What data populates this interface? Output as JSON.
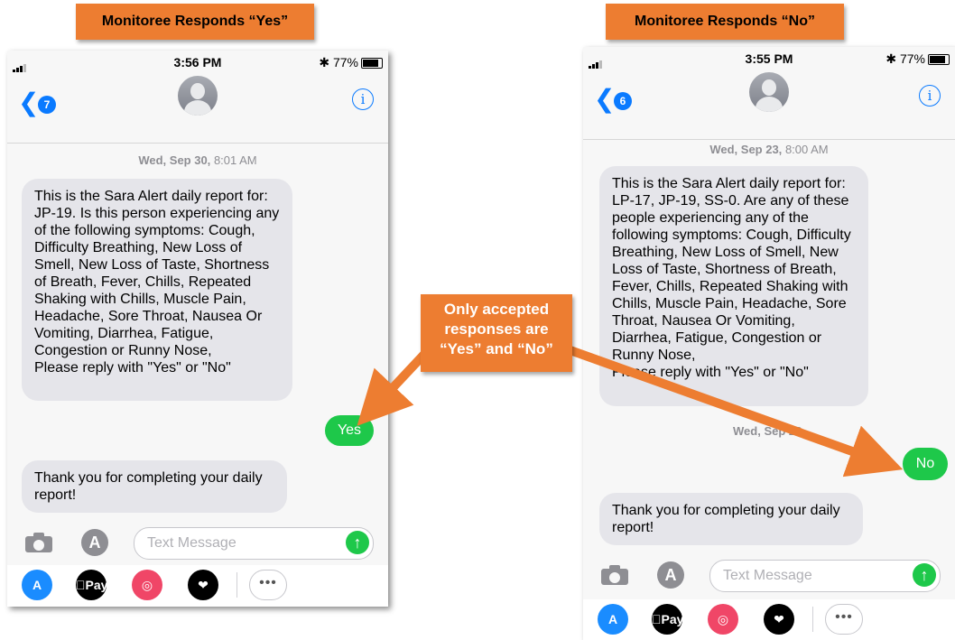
{
  "left": {
    "banner": "Monitoree Responds “Yes”",
    "time": "3:56 PM",
    "battery": "77%",
    "back_count": "7",
    "date_bold": "Wed, Sep 30,",
    "date_time": "8:01 AM",
    "message": "This is the Sara Alert daily report for: JP-19. Is this person experiencing any of the following symptoms: Cough, Difficulty Breathing, New Loss of Smell, New Loss of Taste, Shortness of Breath, Fever, Chills, Repeated Shaking with Chills, Muscle Pain, Headache, Sore Throat, Nausea Or Vomiting, Diarrhea, Fatigue, Congestion or Runny Nose,",
    "message_reply": "Please reply with \"Yes\" or \"No\"",
    "response": "Yes",
    "thanks": "Thank you for completing your daily report!",
    "placeholder": "Text Message"
  },
  "right": {
    "banner": "Monitoree Responds “No”",
    "time": "3:55 PM",
    "battery": "77%",
    "back_count": "6",
    "date_bold": "Wed, Sep 23,",
    "date_time": "8:00 AM",
    "message": "This is the Sara Alert daily report for: LP-17, JP-19, SS-0. Are any of these people experiencing any of the following symptoms: Cough, Difficulty Breathing, New Loss of Smell, New Loss of Taste, Shortness of Breath, Fever, Chills, Repeated Shaking with Chills, Muscle Pain, Headache, Sore Throat, Nausea Or Vomiting, Diarrhea, Fatigue, Congestion or Runny Nose,",
    "message_reply": "Please reply with \"Yes\" or \"No\"",
    "date2": "Wed, Sep 23,",
    "response": "No",
    "thanks": "Thank you for completing your daily report!",
    "placeholder": "Text Message"
  },
  "callout": {
    "line1": "Only accepted",
    "line2": "responses are",
    "line3": "“Yes” and “No”"
  },
  "drawer": {
    "apple_pay": "Pay"
  },
  "colors": {
    "orange": "#ED7D31",
    "imessage_blue": "#0A7AFF",
    "green": "#1EC84A",
    "bubble_gray": "#E5E5EA"
  }
}
